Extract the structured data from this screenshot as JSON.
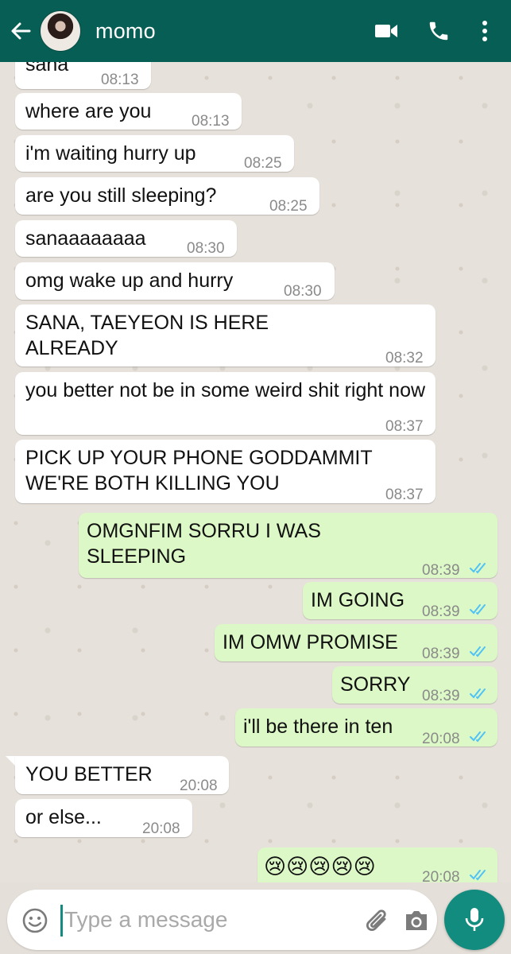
{
  "header": {
    "contact_name": "momo",
    "bg_color": "#075e54",
    "icons": [
      "back-arrow-icon",
      "video-call-icon",
      "phone-icon",
      "more-options-icon"
    ]
  },
  "messages": [
    {
      "dir": "in",
      "text": "sana",
      "time": "08:13"
    },
    {
      "dir": "in",
      "text": "where are you",
      "time": "08:13"
    },
    {
      "dir": "in",
      "text": "i'm waiting hurry up",
      "time": "08:25"
    },
    {
      "dir": "in",
      "text": "are you still sleeping?",
      "time": "08:25"
    },
    {
      "dir": "in",
      "text": "sanaaaaaaaa",
      "time": "08:30"
    },
    {
      "dir": "in",
      "text": "omg wake up and hurry",
      "time": "08:30"
    },
    {
      "dir": "in",
      "text": "SANA, TAEYEON IS HERE ALREADY",
      "time": "08:32"
    },
    {
      "dir": "in",
      "text": "you better not be in some weird shit right now",
      "time": "08:37"
    },
    {
      "dir": "in",
      "text": "PICK UP YOUR PHONE GODDAMMIT WE'RE BOTH KILLING YOU",
      "time": "08:37"
    },
    {
      "dir": "out",
      "text": "OMGNFIM SORRU I WAS SLEEPING",
      "time": "08:39",
      "status": "read"
    },
    {
      "dir": "out",
      "text": "IM GOING",
      "time": "08:39",
      "status": "read"
    },
    {
      "dir": "out",
      "text": "IM OMW PROMISE",
      "time": "08:39",
      "status": "read"
    },
    {
      "dir": "out",
      "text": "SORRY",
      "time": "08:39",
      "status": "read"
    },
    {
      "dir": "out",
      "text": "i'll be there in ten",
      "time": "20:08",
      "status": "read"
    },
    {
      "dir": "in",
      "text": "YOU BETTER",
      "time": "20:08"
    },
    {
      "dir": "in",
      "text": "or else...",
      "time": "20:08"
    },
    {
      "dir": "out",
      "text": "😢😢😢😢😢",
      "time": "20:08",
      "status": "read"
    }
  ],
  "composer": {
    "placeholder": "Type a message",
    "value": ""
  },
  "colors": {
    "incoming_bubble": "#ffffff",
    "outgoing_bubble": "#dcf8c6",
    "read_ticks": "#4fc3f7",
    "accent": "#128c7e"
  }
}
